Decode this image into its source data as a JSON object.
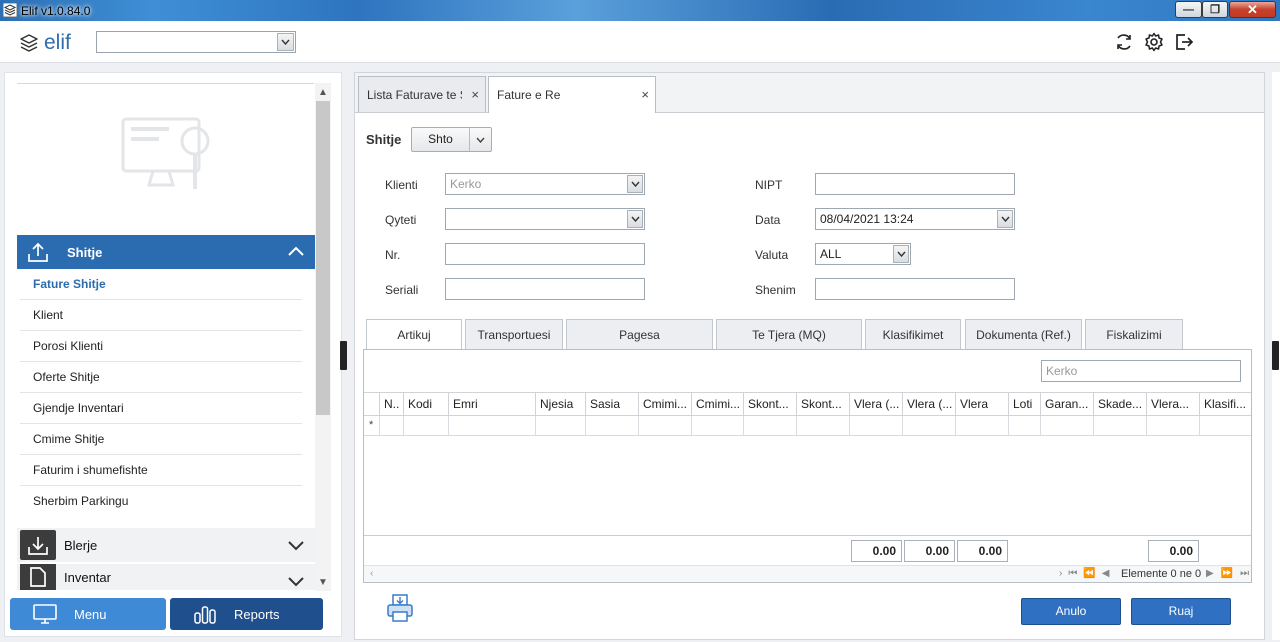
{
  "window": {
    "title": "Elif v1.0.84.0"
  },
  "topbar": {
    "logo_text": "elif",
    "selector_value": "",
    "icons": [
      "refresh-icon",
      "gear-icon",
      "logout-icon"
    ]
  },
  "sidebar": {
    "active_section": "Shitje",
    "items": [
      "Fature Shitje",
      "Klient",
      "Porosi Klienti",
      "Oferte Shitje",
      "Gjendje Inventari",
      "Cmime Shitje",
      "Faturim i shumefishte",
      "Sherbim Parkingu"
    ],
    "sections": [
      "Blerje",
      "Inventar"
    ],
    "menu_label": "Menu",
    "reports_label": "Reports"
  },
  "tabs": [
    {
      "label": "Lista Faturave te Shitjes"
    },
    {
      "label": "Fature e Re"
    }
  ],
  "form": {
    "title": "Shitje",
    "action_label": "Shto",
    "fields": {
      "klienti_label": "Klienti",
      "klienti_placeholder": "Kerko",
      "qyteti_label": "Qyteti",
      "qyteti_value": "",
      "nr_label": "Nr.",
      "nr_value": "",
      "seriali_label": "Seriali",
      "seriali_value": "",
      "nipt_label": "NIPT",
      "nipt_value": "",
      "data_label": "Data",
      "data_value": "08/04/2021 13:24",
      "valuta_label": "Valuta",
      "valuta_value": "ALL",
      "shenim_label": "Shenim",
      "shenim_value": ""
    }
  },
  "inner_tabs": [
    "Artikuj",
    "Transportuesi",
    "Pagesa",
    "Te Tjera (MQ)",
    "Klasifikimet",
    "Dokumenta (Ref.)",
    "Fiskalizimi"
  ],
  "grid": {
    "search_placeholder": "Kerko",
    "columns": [
      "N..",
      "Kodi",
      "Emri",
      "Njesia",
      "Sasia",
      "Cmimi...",
      "Cmimi...",
      "Skont...",
      "Skont...",
      "Vlera (...",
      "Vlera (...",
      "Vlera",
      "Loti",
      "Garan...",
      "Skade...",
      "Vlera...",
      "Klasifi..."
    ],
    "new_row_marker": "*",
    "totals": [
      "0.00",
      "0.00",
      "0.00",
      "0.00"
    ],
    "pager_text": "Elemente 0 ne 0"
  },
  "actions": {
    "cancel_label": "Anulo",
    "save_label": "Ruaj"
  },
  "colors": {
    "primary": "#2b6cb0",
    "menu_button": "#3e8ad6",
    "reports_button": "#1f4f8c",
    "action_button": "#2f70c2"
  }
}
